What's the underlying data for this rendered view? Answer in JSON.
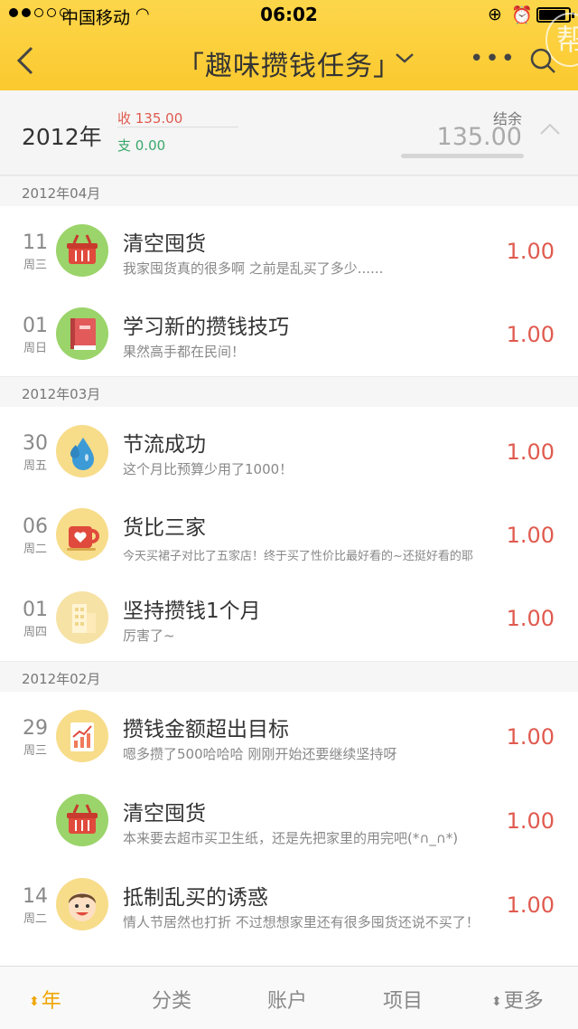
{
  "status_bar": {
    "carrier": "中国移动",
    "time": "06:02"
  },
  "nav": {
    "title": "「趣味攒钱任务」",
    "back_icon": "chevron-left-icon",
    "more_label": "•••",
    "badge_text": "帮"
  },
  "summary": {
    "year": "2012年",
    "income": "收 135.00",
    "expense": "支 0.00",
    "balance_label": "结余",
    "balance": "135.00"
  },
  "groups": [
    {
      "month": "2012年04月",
      "items": [
        {
          "day": "11",
          "weekday": "周三",
          "icon": "basket-icon",
          "title": "清空囤货",
          "note": "我家囤货真的很多啊 之前是乱买了多少......",
          "amount": "1.00"
        },
        {
          "day": "01",
          "weekday": "周日",
          "icon": "book-icon",
          "title": "学习新的攒钱技巧",
          "note": "果然高手都在民间！",
          "amount": "1.00"
        }
      ]
    },
    {
      "month": "2012年03月",
      "items": [
        {
          "day": "30",
          "weekday": "周五",
          "icon": "water-drop-icon",
          "title": "节流成功",
          "note": "这个月比预算少用了1000！",
          "amount": "1.00"
        },
        {
          "day": "06",
          "weekday": "周二",
          "icon": "heart-cup-icon",
          "title": "货比三家",
          "note": "今天买裙子对比了五家店！终于买了性价比最好看的~还挺好看的耶",
          "amount": "1.00"
        },
        {
          "day": "01",
          "weekday": "周四",
          "icon": "building-icon",
          "title": "坚持攒钱1个月",
          "note": "厉害了~",
          "amount": "1.00"
        }
      ]
    },
    {
      "month": "2012年02月",
      "items": [
        {
          "day": "29",
          "weekday": "周三",
          "icon": "trend-chart-icon",
          "title": "攒钱金额超出目标",
          "note": "嗯多攒了500哈哈哈 刚刚开始还要继续坚持呀",
          "amount": "1.00"
        },
        {
          "day": "",
          "weekday": "",
          "icon": "basket-icon",
          "title": "清空囤货",
          "note": "本来要去超市买卫生纸，还是先把家里的用完吧(*∩_∩*)",
          "amount": "1.00"
        },
        {
          "day": "14",
          "weekday": "周二",
          "icon": "smiling-face-icon",
          "title": "抵制乱买的诱惑",
          "note": "情人节居然也打折 不过想想家里还有很多囤货还说不买了！",
          "amount": "1.00"
        }
      ]
    }
  ],
  "tabs": [
    {
      "label": "年",
      "icon": "sort-arrows-icon",
      "active": true
    },
    {
      "label": "分类"
    },
    {
      "label": "账户"
    },
    {
      "label": "项目"
    },
    {
      "label": "更多",
      "icon": "sort-arrows-icon"
    }
  ],
  "colors": {
    "header": "#fbc92f",
    "income": "#e05a4f",
    "expense": "#3aa86c",
    "amount": "#e05a4f",
    "active_tab": "#f0a500"
  }
}
